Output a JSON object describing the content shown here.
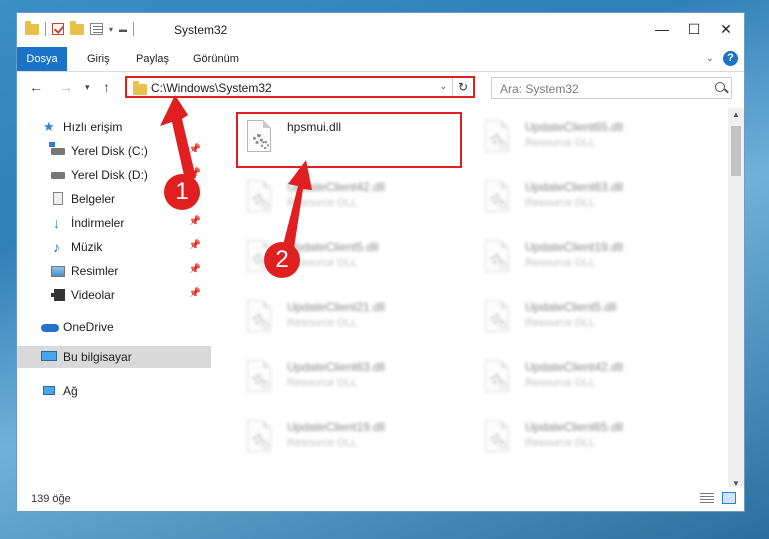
{
  "window": {
    "title": "System32"
  },
  "ribbon": {
    "tabs": [
      "Dosya",
      "Giriş",
      "Paylaş",
      "Görünüm"
    ]
  },
  "address": {
    "path": "C:\\Windows\\System32"
  },
  "search": {
    "placeholder": "Ara: System32"
  },
  "sidebar": {
    "items": [
      {
        "label": "Hızlı erişim",
        "icon": "star-icon"
      },
      {
        "label": "Yerel Disk (C:)",
        "icon": "drive-c-icon"
      },
      {
        "label": "Yerel Disk (D:)",
        "icon": "drive-icon"
      },
      {
        "label": "Belgeler",
        "icon": "documents-icon"
      },
      {
        "label": "İndirmeler",
        "icon": "download-icon"
      },
      {
        "label": "Müzik",
        "icon": "music-icon"
      },
      {
        "label": "Resimler",
        "icon": "pictures-icon"
      },
      {
        "label": "Videolar",
        "icon": "videos-icon"
      },
      {
        "label": "OneDrive",
        "icon": "cloud-icon"
      },
      {
        "label": "Bu bilgisayar",
        "icon": "computer-icon"
      },
      {
        "label": "Ağ",
        "icon": "network-icon"
      }
    ]
  },
  "files": [
    {
      "name": "hpsmui.dll",
      "type": ""
    },
    {
      "name": "UpdateClient65.dll",
      "type": "Resource DLL"
    },
    {
      "name": "UpdateClient42.dll",
      "type": "Resource DLL"
    },
    {
      "name": "UpdateClient63.dll",
      "type": "Resource DLL"
    },
    {
      "name": "UpdateClient5.dll",
      "type": "Resource DLL"
    },
    {
      "name": "UpdateClient19.dll",
      "type": "Resource DLL"
    },
    {
      "name": "UpdateClient21.dll",
      "type": "Resource DLL"
    },
    {
      "name": "UpdateClient5.dll",
      "type": "Resource DLL"
    },
    {
      "name": "UpdateClient63.dll",
      "type": "Resource DLL"
    },
    {
      "name": "UpdateClient42.dll",
      "type": "Resource DLL"
    },
    {
      "name": "UpdateClient19.dll",
      "type": "Resource DLL"
    },
    {
      "name": "UpdateClient65.dll",
      "type": "Resource DLL"
    }
  ],
  "status": {
    "count": "139 öğe"
  },
  "annotations": {
    "step1": "1",
    "step2": "2",
    "color": "#e02020"
  }
}
